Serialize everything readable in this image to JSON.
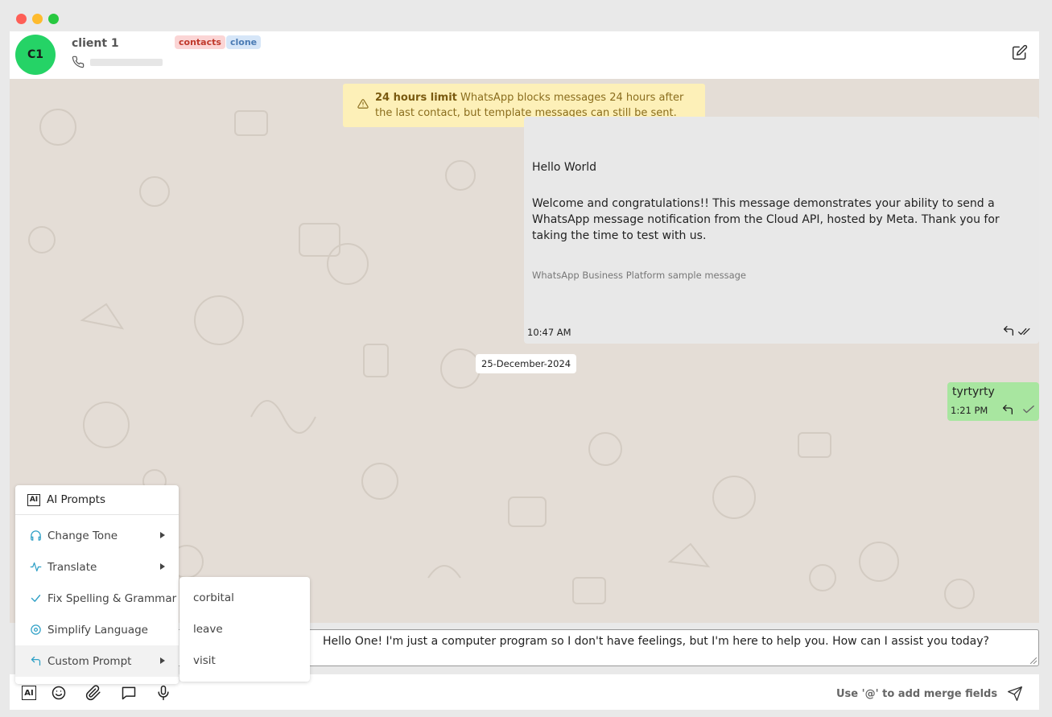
{
  "contact": {
    "initials": "C1",
    "name": "client 1",
    "tags": [
      "contacts",
      "clone"
    ]
  },
  "warning": {
    "bold": "24 hours limit",
    "text": " WhatsApp blocks messages 24 hours after the last contact, but template messages can still be sent."
  },
  "template_message": {
    "title": "Hello World",
    "body": "Welcome and congratulations!! This message demonstrates your ability to send a WhatsApp message notification from the Cloud API, hosted by Meta. Thank you for taking the time to test with us.",
    "footer": "WhatsApp Business Platform sample message",
    "time": "10:47 AM"
  },
  "date_separator": "25-December-2024",
  "outgoing_message": {
    "text": "tyrtyrty",
    "time": "1:21 PM"
  },
  "composer": {
    "value": "Hello One! I'm just a computer program so I don't have feelings, but I'm here to help you. How can I assist you today?"
  },
  "toolbar": {
    "ai_label": "AI",
    "merge_hint": "Use '@' to add merge fields"
  },
  "ai_menu": {
    "header": "AI Prompts",
    "header_icon_label": "AI",
    "items": [
      {
        "label": "Change Tone",
        "icon": "headphones-icon"
      },
      {
        "label": "Translate",
        "icon": "pulse-icon"
      },
      {
        "label": "Fix Spelling & Grammar",
        "icon": "check-icon"
      },
      {
        "label": "Simplify Language",
        "icon": "target-icon"
      },
      {
        "label": "Custom Prompt",
        "icon": "reply-arrow-icon"
      }
    ]
  },
  "custom_prompt_submenu": {
    "items": [
      "corbital",
      "leave",
      "visit"
    ]
  },
  "colors": {
    "avatar": "#25d366",
    "outgoing_bubble": "#a8e6a0",
    "warning_bg": "#fdf0b8",
    "accent": "#2fa0c6"
  }
}
